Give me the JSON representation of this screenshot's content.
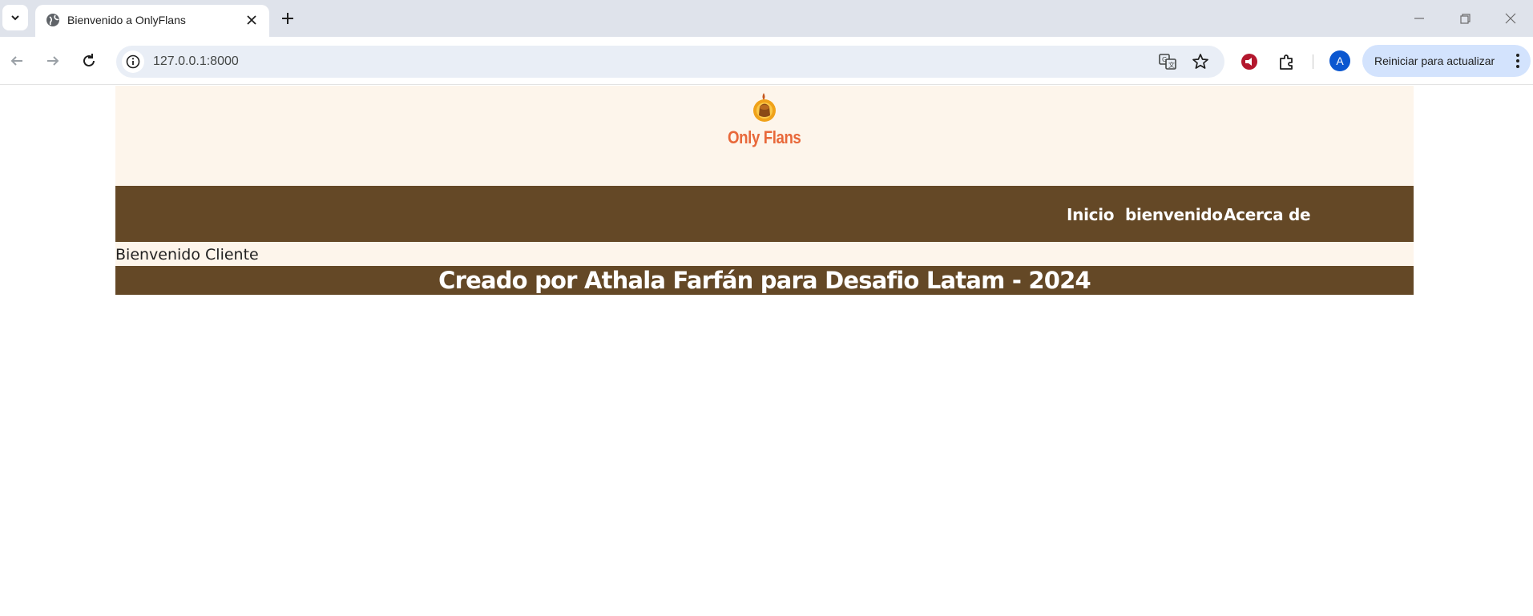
{
  "browser": {
    "tab": {
      "title": "Bienvenido a OnlyFlans"
    },
    "address_bar": {
      "url": "127.0.0.1:8000"
    },
    "profile_initial": "A",
    "update_button_label": "Reiniciar para actualizar"
  },
  "site": {
    "logo_text": "Only Flans",
    "nav": {
      "items": [
        {
          "label": "Inicio"
        },
        {
          "label": "bienvenido"
        },
        {
          "label": "Acerca de"
        }
      ]
    },
    "welcome_text": "Bienvenido Cliente",
    "footer_text": "Creado por Athala Farfán para Desafio Latam - 2024"
  },
  "colors": {
    "header_bg": "#fdf5eb",
    "nav_bg": "#644826",
    "logo_orange": "#e8683a",
    "chrome_tabstrip": "#dfe3eb"
  }
}
